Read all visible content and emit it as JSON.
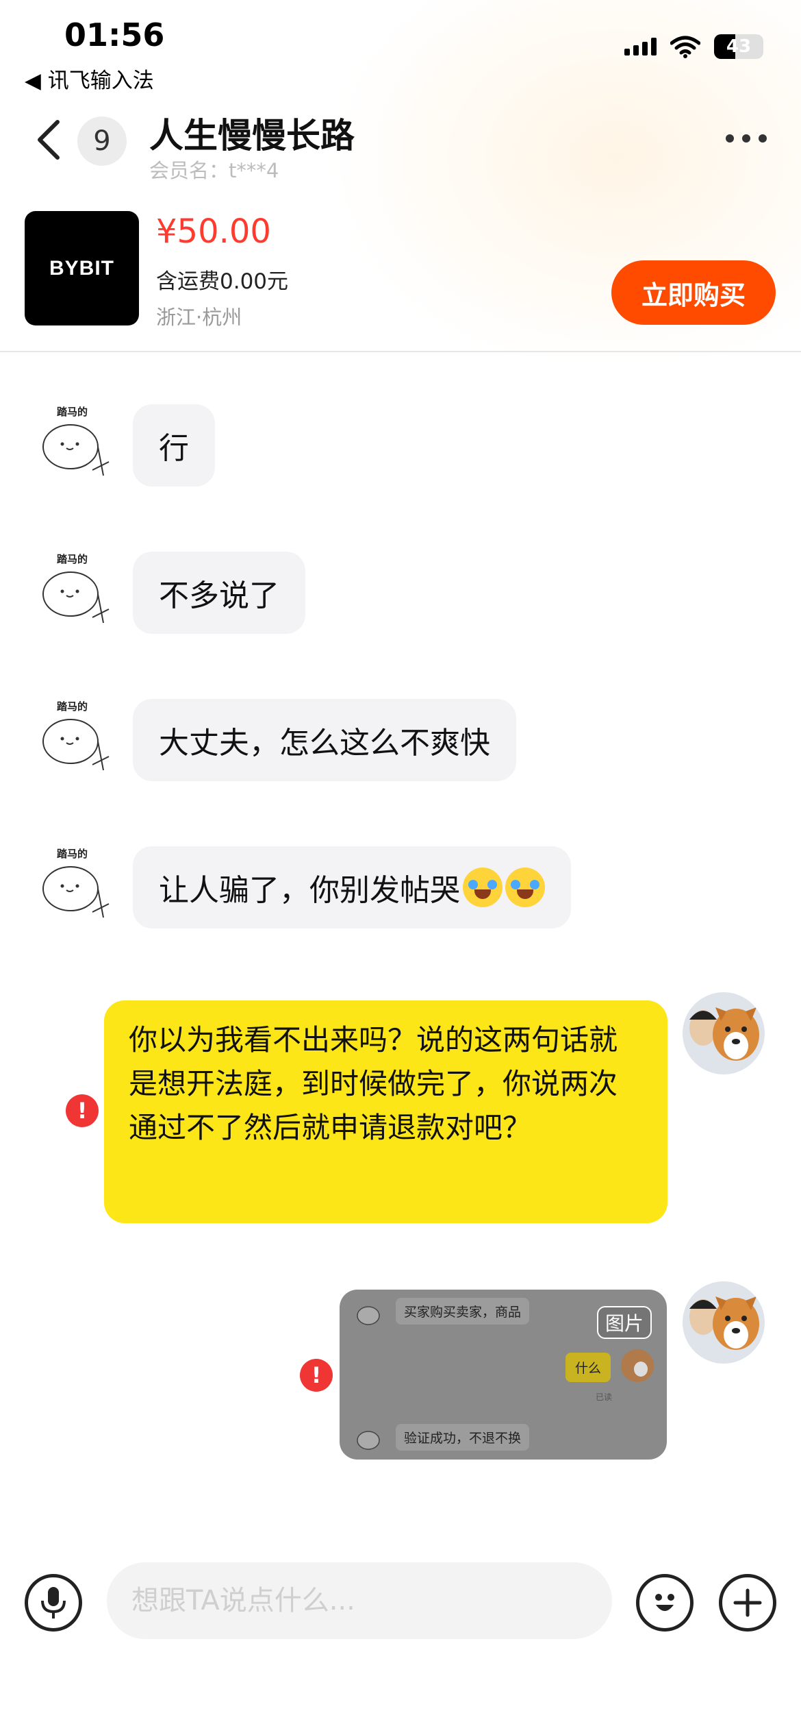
{
  "status_bar": {
    "time": "01:56",
    "back_app": "◀ 讯飞输入法",
    "battery": "43",
    "battery_fraction": 0.43
  },
  "header": {
    "unread_count": "9",
    "contact_name": "人生慢慢长路",
    "member_label": "会员名：t***4"
  },
  "product": {
    "brand_text": "BYBIT",
    "price": "¥50.00",
    "shipping": "含运费0.00元",
    "location": "浙江·杭州",
    "buy_button": "立即购买"
  },
  "messages": [
    {
      "side": "left",
      "avatar_text": "踏马的",
      "text": "行"
    },
    {
      "side": "left",
      "avatar_text": "踏马的",
      "text": "不多说了"
    },
    {
      "side": "left",
      "avatar_text": "踏马的",
      "text": "大丈夫，怎么这么不爽快"
    },
    {
      "side": "left",
      "avatar_text": "踏马的",
      "text": "让人骗了，你别发帖哭",
      "emoji_count": 2
    },
    {
      "side": "right",
      "status": "failed",
      "text": "你以为我看不出来吗？说的这两句话就是想开法庭，到时候做完了，你说两次通过不了然后就申请退款对吧？"
    },
    {
      "side": "right",
      "status": "failed",
      "type": "image",
      "tag": "图片",
      "preview": {
        "top_text": "买家购买卖家，商品",
        "reply_text": "什么",
        "read_text": "已读",
        "bottom_text": "验证成功，不退不换"
      }
    }
  ],
  "input": {
    "placeholder": "想跟TA说点什么..."
  },
  "colors": {
    "accent": "#ff4b00",
    "price": "#ff3b30",
    "my_bubble": "#fde617",
    "their_bubble": "#f3f3f5",
    "error": "#f03535"
  }
}
